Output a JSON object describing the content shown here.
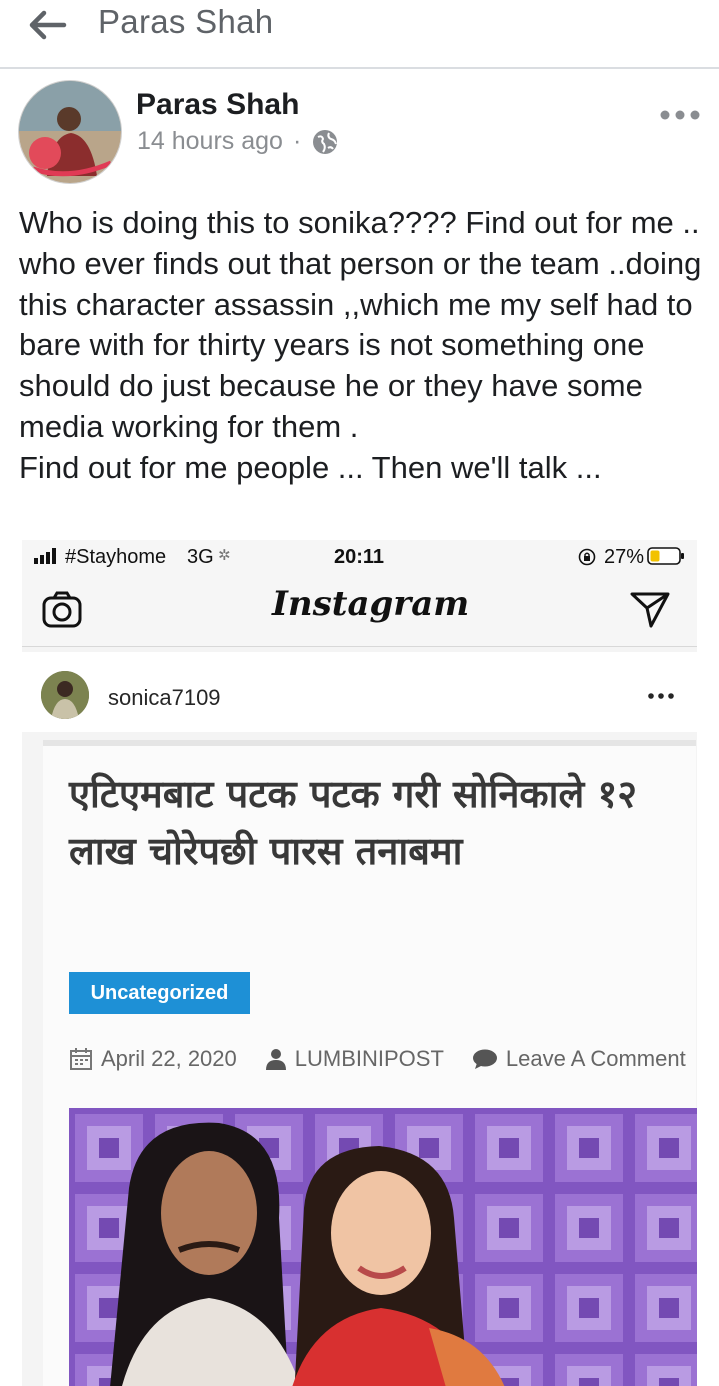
{
  "topbar": {
    "title": "Paras Shah"
  },
  "post": {
    "author": "Paras Shah",
    "time": "14 hours ago",
    "separator": "·",
    "paragraph1": "Who is doing this to sonika???? Find out for me .. who ever finds out that person or the team ..doing this character assassin ,,which me my self had to bare with for thirty years is not something one should do just because he or they have some media working for them .",
    "paragraph2": "Find out for me people ... Then we'll talk ..."
  },
  "screenshot": {
    "status": {
      "carrier": "#Stayhome",
      "network": "3G",
      "time": "20:11",
      "battery": "27%"
    },
    "app_title": "Instagram",
    "ig_user": "sonica7109",
    "article": {
      "headline": "एटिएमबाट पटक पटक गरी सोनिकाले १२ लाख चोरेपछी पारस तनाबमा",
      "category": "Uncategorized",
      "date": "April 22, 2020",
      "author": "LUMBINIPOST",
      "comment": "Leave A Comment"
    }
  },
  "colors": {
    "accent": "#1e90d6",
    "muted_text": "#8a8d91",
    "photo_background": "#8a5cc4"
  }
}
